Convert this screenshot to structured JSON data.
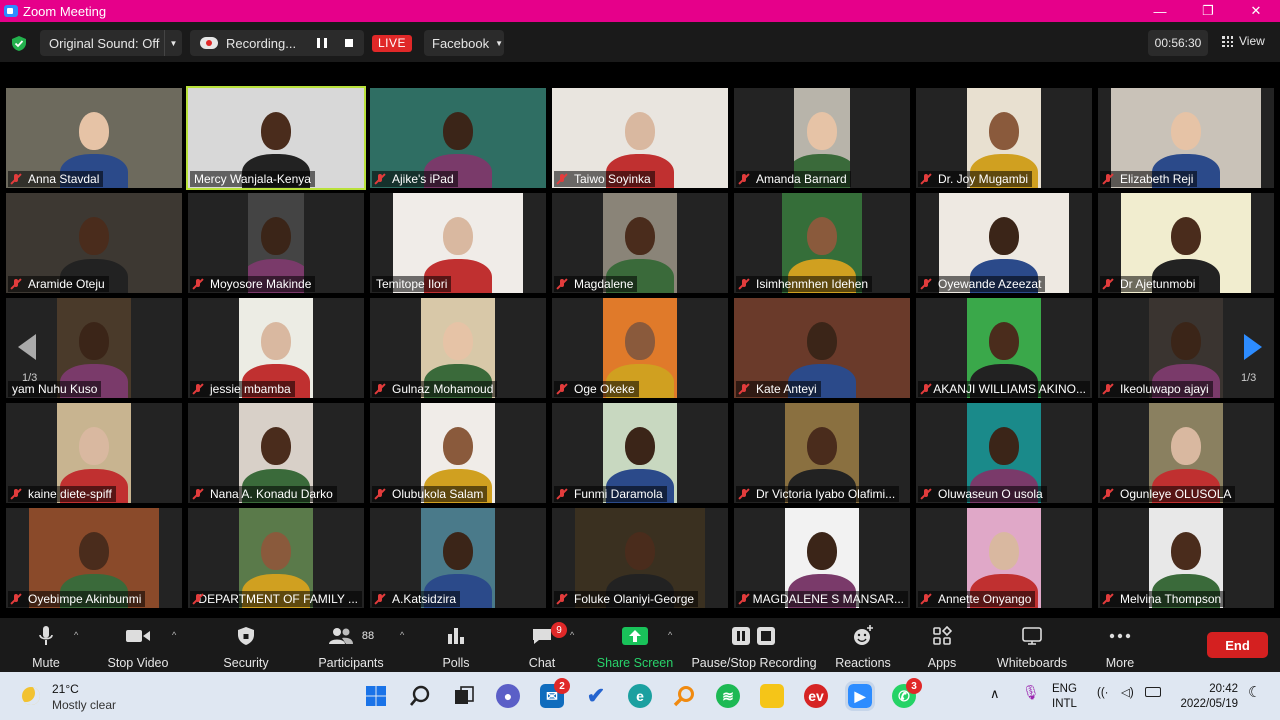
{
  "window": {
    "title": "Zoom Meeting",
    "controls": [
      "—",
      "❐",
      "✕"
    ]
  },
  "topbar": {
    "original_sound": "Original Sound: Off",
    "recording": "Recording...",
    "live": "LIVE",
    "stream_target": "Facebook",
    "timer": "00:56:30",
    "view": "View"
  },
  "gallery": {
    "page_left": "1/3",
    "page_right": "1/3",
    "participants": [
      {
        "name": "Anna Stavdal",
        "muted": true
      },
      {
        "name": "Mercy Wanjala-Kenya",
        "muted": false,
        "active_speaker": true
      },
      {
        "name": "Ajike's iPad",
        "muted": true
      },
      {
        "name": "Taiwo Soyinka",
        "muted": true
      },
      {
        "name": "Amanda Barnard",
        "muted": true
      },
      {
        "name": "Dr. Joy Mugambi",
        "muted": true
      },
      {
        "name": "Elizabeth Reji",
        "muted": true
      },
      {
        "name": "Aramide Oteju",
        "muted": true
      },
      {
        "name": "Moyosore Makinde",
        "muted": true
      },
      {
        "name": "Temitope Ilori",
        "muted": false
      },
      {
        "name": "Magdalene",
        "muted": true
      },
      {
        "name": "Isimhenmhen Idehen",
        "muted": true
      },
      {
        "name": "Oyewande Azeezat",
        "muted": true
      },
      {
        "name": "Dr Ajetunmobi",
        "muted": true
      },
      {
        "name": "yam Nuhu Kuso",
        "muted": false
      },
      {
        "name": "jessie mbamba",
        "muted": true
      },
      {
        "name": "Gulnaz Mohamoud",
        "muted": true
      },
      {
        "name": "Oge Okeke",
        "muted": true
      },
      {
        "name": "Kate Anteyi",
        "muted": true
      },
      {
        "name": "AKANJI WILLIAMS AKINO...",
        "muted": true
      },
      {
        "name": "Ikeoluwapo ajayi",
        "muted": true
      },
      {
        "name": "kaine diete-spiff",
        "muted": true
      },
      {
        "name": "Nana A. Konadu Darko",
        "muted": true
      },
      {
        "name": "Olubukola Salam",
        "muted": true
      },
      {
        "name": "Funmi Daramola",
        "muted": true
      },
      {
        "name": "Dr Victoria Iyabo Olafimi...",
        "muted": true
      },
      {
        "name": "Oluwaseun O usola",
        "muted": true
      },
      {
        "name": "Ogunleye OLUSOLA",
        "muted": true
      },
      {
        "name": "Oyebimpe Akinbunmi",
        "muted": true
      },
      {
        "name": "DEPARTMENT OF FAMILY ...",
        "muted": true
      },
      {
        "name": "A.Katsidzira",
        "muted": true
      },
      {
        "name": "Foluke Olaniyi-George",
        "muted": true
      },
      {
        "name": "MAGDALENE S MANSAR...",
        "muted": true
      },
      {
        "name": "Annette Onyango",
        "muted": true
      },
      {
        "name": "Melvina Thompson",
        "muted": true
      }
    ]
  },
  "toolbar": {
    "mute": "Mute",
    "stop_video": "Stop Video",
    "security": "Security",
    "participants": "Participants",
    "participants_count": "88",
    "polls": "Polls",
    "chat": "Chat",
    "chat_badge": "9",
    "share_screen": "Share Screen",
    "pause_stop_recording": "Pause/Stop Recording",
    "reactions": "Reactions",
    "apps": "Apps",
    "whiteboards": "Whiteboards",
    "more": "More",
    "end": "End"
  },
  "taskbar": {
    "weather_temp": "21°C",
    "weather_desc": "Mostly clear",
    "mail_badge": "2",
    "whatsapp_badge": "3",
    "lang1": "ENG",
    "lang2": "INTL",
    "time": "20:42",
    "date": "2022/05/19"
  }
}
